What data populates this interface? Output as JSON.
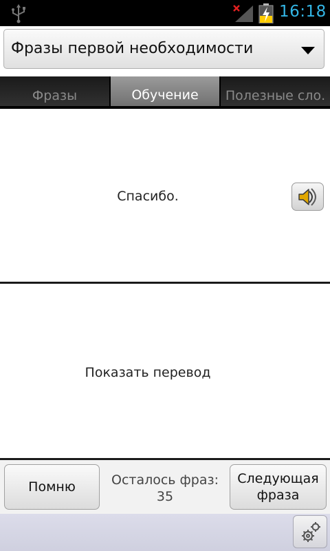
{
  "status_bar": {
    "time": "16:18"
  },
  "category_select": {
    "value": "Фразы первой необходимости"
  },
  "tabs": [
    {
      "label": "Фразы"
    },
    {
      "label": "Обучение"
    },
    {
      "label": "Полезные сло."
    }
  ],
  "phrase": {
    "text": "Спасибо."
  },
  "translation": {
    "label": "Показать перевод"
  },
  "controls": {
    "remember_label": "Помню",
    "remaining_label": "Осталось фраз:",
    "remaining_count": "35",
    "next_line_1": "Следующая",
    "next_line_2": "фраза"
  },
  "icons": {
    "usb": "usb-icon",
    "signal": "signal-icon",
    "battery": "battery-charging-icon",
    "dropdown": "dropdown-arrow-icon",
    "speaker": "speaker-icon",
    "settings": "gears-icon"
  },
  "colors": {
    "clock": "#33b5e5",
    "active_tab": "#808080"
  }
}
